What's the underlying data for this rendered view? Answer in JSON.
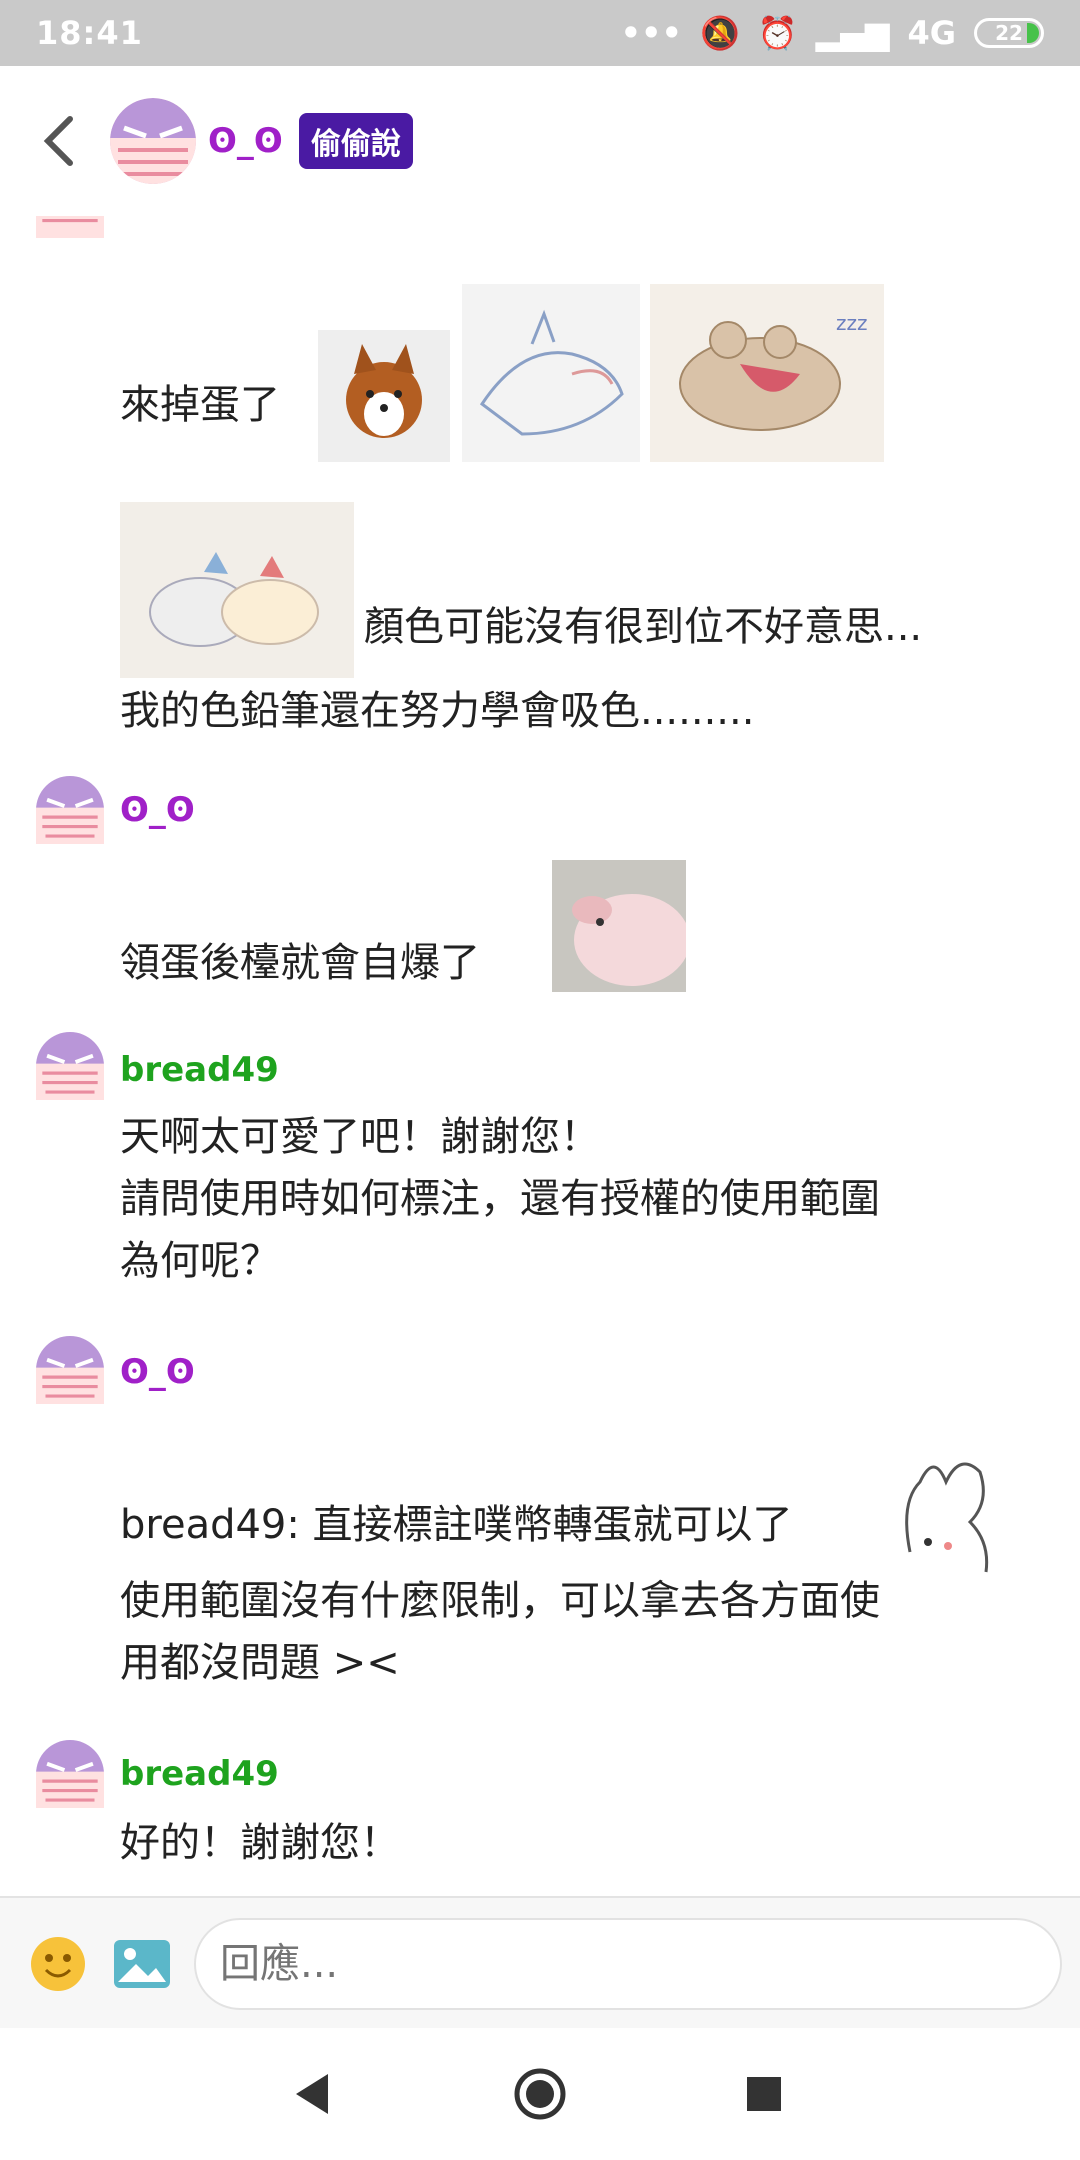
{
  "status_bar": {
    "time": "18:41",
    "network": "4G",
    "battery": "22"
  },
  "header": {
    "title": "ʘ_ʘ",
    "badge": "偷偷說"
  },
  "messages": [
    {
      "text": "來掉蛋了",
      "caption_after_image": "顏色可能沒有很到位不好意思...",
      "line2": "我的色鉛筆還在努力學會吸色........."
    },
    {
      "sender": "ʘ_ʘ",
      "text": "領蛋後檯就會自爆了"
    },
    {
      "sender": "bread49",
      "lines": [
        "天啊太可愛了吧！謝謝您！",
        "請問使用時如何標注，還有授權的使用範圍",
        "為何呢？"
      ]
    },
    {
      "sender": "ʘ_ʘ",
      "lines": [
        "bread49: 直接標註噗幣轉蛋就可以了",
        "使用範圍沒有什麼限制，可以拿去各方面使",
        "用都沒問題 ><"
      ]
    },
    {
      "sender": "bread49",
      "text": "好的！謝謝您！"
    }
  ],
  "composer": {
    "placeholder": "回應..."
  },
  "colors": {
    "purple_name": "#a020c8",
    "green_name": "#1ea31e",
    "badge_bg": "#4a1aa3"
  }
}
